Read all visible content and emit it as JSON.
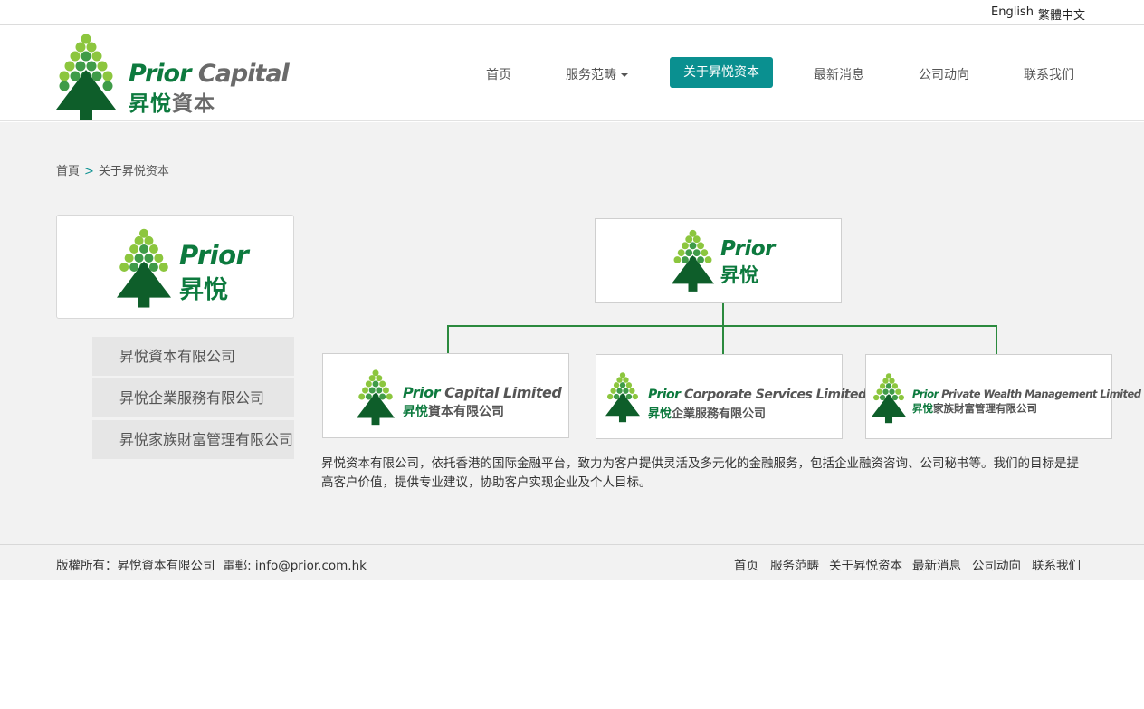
{
  "lang": {
    "english": "English",
    "traditional": "繁體中文"
  },
  "brand": {
    "name_en_a": "Prior",
    "name_en_b": "Capital",
    "name_cn_a": "昇悅",
    "name_cn_b": "資本",
    "short_en": "Prior",
    "short_cn": "昇悅",
    "green": "#0d7a3e",
    "teal": "#0a9090"
  },
  "nav": {
    "home": "首页",
    "services": "服务范畴",
    "about": "关于昇悦资本",
    "news": "最新消息",
    "company": "公司动向",
    "contact": "联系我们"
  },
  "breadcrumb": {
    "home": "首頁",
    "sep": ">",
    "current": "关于昇悦资本"
  },
  "side_menu": [
    "昇悅資本有限公司",
    "昇悅企業服務有限公司",
    "昇悅家族財富管理有限公司"
  ],
  "org": {
    "capital_en_a": "Prior",
    "capital_en_b": "Capital Limited",
    "capital_cn_a": "昇悅",
    "capital_cn_b": "資本有限公司",
    "corporate_en_a": "Prior",
    "corporate_en_b": "Corporate Services Limited",
    "corporate_cn_a": "昇悅",
    "corporate_cn_b": "企業服務有限公司",
    "wealth_en_a": "Prior",
    "wealth_en_b": "Private Wealth Management Limited",
    "wealth_cn_a": "昇悅",
    "wealth_cn_b": "家族財富管理有限公司"
  },
  "intro": "昇悦资本有限公司，依托香港的国际金融平台，致力为客户提供灵活及多元化的金融服务，包括企业融资咨询、公司秘书等。我们的目标是提高客户价值，提供专业建议，协助客户实现企业及个人目标。",
  "footer": {
    "copyright": "版權所有：昇悅資本有限公司  電郵: info@prior.com.hk",
    "links": [
      "首页",
      "服务范畴",
      "关于昇悦资本",
      "最新消息",
      "公司动向",
      "联系我们"
    ]
  }
}
